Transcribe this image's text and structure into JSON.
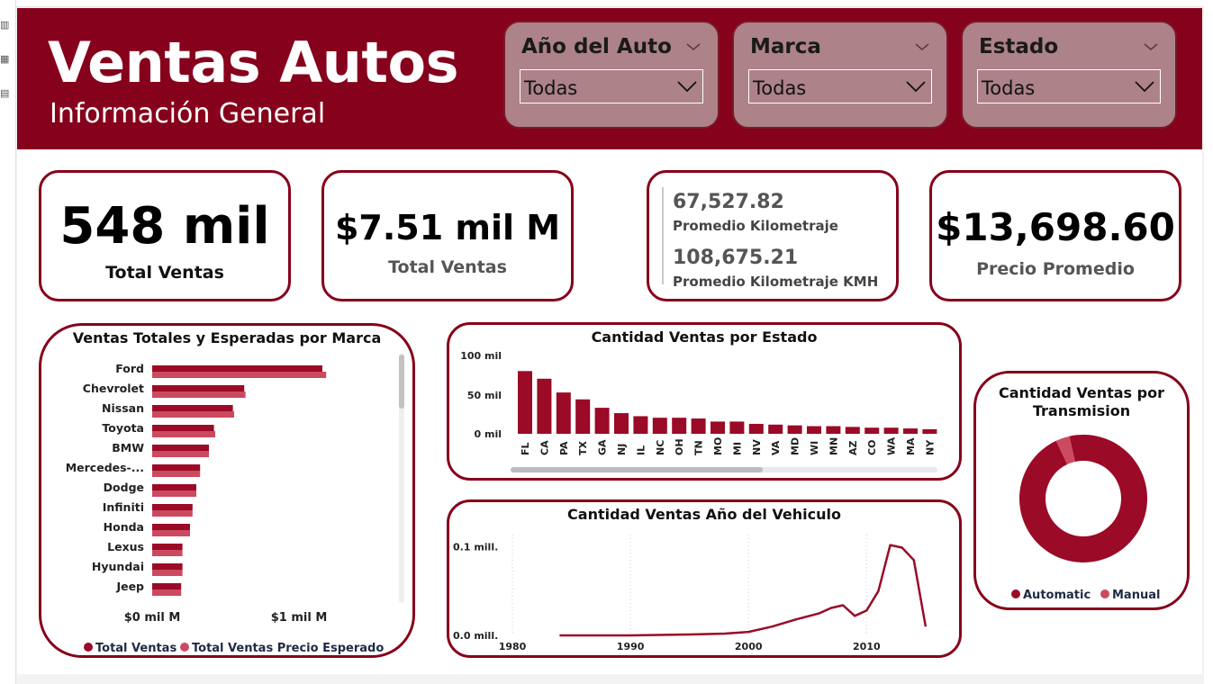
{
  "header": {
    "title": "Ventas Autos",
    "subtitle": "Información General"
  },
  "filters": [
    {
      "label": "Año del Auto",
      "value": "Todas"
    },
    {
      "label": "Marca",
      "value": "Todas"
    },
    {
      "label": "Estado",
      "value": "Todas"
    }
  ],
  "kpis": {
    "total_units": {
      "value": "548 mil",
      "label": "Total Ventas"
    },
    "total_amount": {
      "value": "$7.51 mil M",
      "label": "Total Ventas"
    },
    "mileage": {
      "value": "67,527.82",
      "label": "Promedio Kilometraje",
      "value_kmh": "108,675.21",
      "label_kmh": "Promedio Kilometraje KMH"
    },
    "avg_price": {
      "value": "$13,698.60",
      "label": "Precio Promedio"
    }
  },
  "colors": {
    "brand": "#86011b",
    "series_primary": "#9b0a26",
    "series_secondary": "#cc4a5f",
    "header_bg": "#86011b",
    "slicer_bg": "#ad8289"
  },
  "chart_data": [
    {
      "type": "bar",
      "orientation": "horizontal",
      "title": "Ventas Totales y Esperadas por Marca",
      "categories": [
        "Ford",
        "Chevrolet",
        "Nissan",
        "Toyota",
        "BMW",
        "Mercedes-...",
        "Dodge",
        "Infiniti",
        "Honda",
        "Lexus",
        "Hyundai",
        "Jeep"
      ],
      "series": [
        {
          "name": "Total Ventas",
          "values": [
            1.35,
            0.73,
            0.64,
            0.49,
            0.45,
            0.38,
            0.35,
            0.32,
            0.3,
            0.24,
            0.24,
            0.23
          ]
        },
        {
          "name": "Total Ventas Precio Esperado",
          "values": [
            1.38,
            0.74,
            0.65,
            0.5,
            0.45,
            0.38,
            0.35,
            0.32,
            0.3,
            0.24,
            0.24,
            0.23
          ]
        }
      ],
      "x_ticks": [
        "$0 mil M",
        "$1 mil M"
      ],
      "xlim": [
        0,
        1.5
      ],
      "unit": "mil M",
      "legend": "bottom"
    },
    {
      "type": "bar",
      "title": "Cantidad Ventas por Estado",
      "categories": [
        "FL",
        "CA",
        "PA",
        "TX",
        "GA",
        "NJ",
        "IL",
        "NC",
        "OH",
        "TN",
        "MO",
        "MI",
        "NV",
        "VA",
        "MD",
        "WI",
        "MN",
        "AZ",
        "CO",
        "WA",
        "MA",
        "NY"
      ],
      "values": [
        82,
        72,
        54,
        45,
        34,
        27,
        23,
        21,
        21,
        20,
        16,
        16,
        13,
        12,
        11,
        10,
        10,
        9,
        8,
        8,
        7,
        6
      ],
      "unit": "mil",
      "y_ticks": [
        "0 mil",
        "50 mil",
        "100 mil"
      ],
      "ylim": [
        0,
        100
      ],
      "grid": false
    },
    {
      "type": "line",
      "title": "Cantidad Ventas Año del Vehiculo",
      "x": [
        1984,
        1990,
        1995,
        1998,
        2000,
        2002,
        2004,
        2006,
        2007,
        2008,
        2009,
        2010,
        2011,
        2012,
        2013,
        2014,
        2015
      ],
      "y": [
        0.0,
        0.0,
        0.001,
        0.002,
        0.004,
        0.01,
        0.018,
        0.025,
        0.031,
        0.034,
        0.022,
        0.028,
        0.05,
        0.102,
        0.099,
        0.085,
        0.01
      ],
      "x_ticks": [
        "1980",
        "1990",
        "2000",
        "2010"
      ],
      "y_ticks": [
        "0.0 mill.",
        "0.1 mill."
      ],
      "xlim": [
        1980,
        2016
      ],
      "ylim": [
        0,
        0.13
      ],
      "unit": "mill.",
      "grid": "vertical-dotted"
    },
    {
      "type": "pie",
      "style": "donut",
      "title": "Cantidad Ventas por Transmision",
      "labels": [
        "Automatic",
        "Manual"
      ],
      "values": [
        96.5,
        3.5
      ],
      "legend": "bottom"
    }
  ]
}
